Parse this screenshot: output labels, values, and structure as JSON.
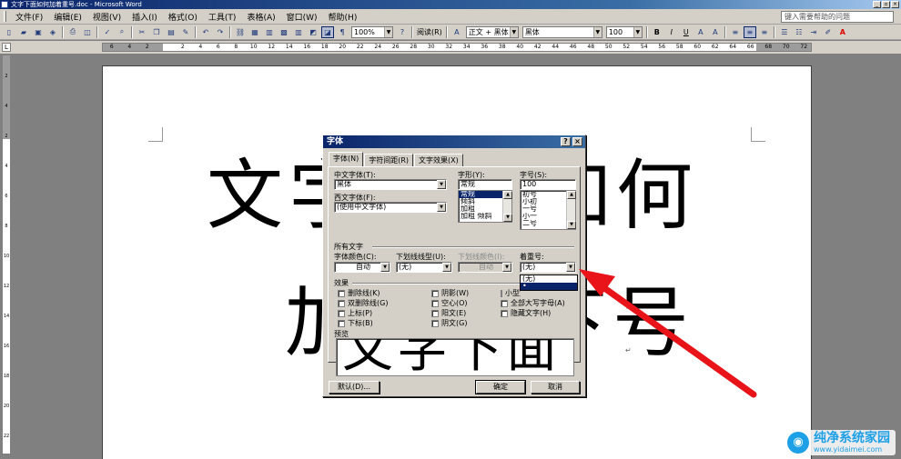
{
  "window": {
    "title": "文字下面如何加着重号.doc - Microsoft Word",
    "buttons": [
      "_",
      "▫",
      "×"
    ]
  },
  "menubar": {
    "items": [
      "文件(F)",
      "编辑(E)",
      "视图(V)",
      "插入(I)",
      "格式(O)",
      "工具(T)",
      "表格(A)",
      "窗口(W)",
      "帮助(H)"
    ],
    "help_placeholder": "键入需要帮助的问题"
  },
  "toolbar": {
    "zoom": "100%",
    "read_label": "阅读(R)",
    "style": "正文 + 黑体",
    "font": "黑体",
    "size": "100",
    "bold": "B",
    "italic": "I",
    "underline": "U",
    "font_color": "A"
  },
  "ruler": {
    "corner": "L",
    "ticks": [
      "6",
      "4",
      "2",
      "",
      "2",
      "4",
      "6",
      "8",
      "10",
      "12",
      "14",
      "16",
      "18",
      "20",
      "22",
      "24",
      "26",
      "28",
      "30",
      "32",
      "34",
      "36",
      "38",
      "40",
      "42",
      "44",
      "46",
      "48",
      "50",
      "52",
      "54",
      "56",
      "58",
      "60",
      "62",
      "64",
      "66",
      "68",
      "70",
      "72"
    ],
    "vticks": [
      "2",
      "4",
      "2",
      "4",
      "6",
      "8",
      "10",
      "12",
      "14",
      "16",
      "18",
      "20",
      "22"
    ]
  },
  "document": {
    "line1": "文字下面如何",
    "line2": "加文字下号",
    "paragraph_mark": "↵"
  },
  "dialog": {
    "title": "字体",
    "help_btn": "?",
    "close_btn": "×",
    "tabs": [
      "字体(N)",
      "字符间距(R)",
      "文字效果(X)"
    ],
    "cn_font_label": "中文字体(T):",
    "cn_font_value": "黑体",
    "west_font_label": "西文字体(F):",
    "west_font_value": "(使用中文字体)",
    "style_label": "字形(Y):",
    "style_value": "常规",
    "style_list": [
      "常规",
      "倾斜",
      "加粗",
      "加粗 倾斜"
    ],
    "size_label": "字号(S):",
    "size_value": "100",
    "size_list": [
      "初号",
      "小初",
      "一号",
      "小一",
      "二号"
    ],
    "all_text_label": "所有文字",
    "color_label": "字体颜色(C):",
    "color_value": "自动",
    "underline_label": "下划线线型(U):",
    "underline_value": "(无)",
    "underline_color_label": "下划线颜色(I):",
    "underline_color_value": "自动",
    "emphasis_label": "着重号:",
    "emphasis_value": "(无)",
    "emphasis_options": [
      "(无)",
      "•"
    ],
    "effects_label": "效果",
    "effects": [
      {
        "label": "删除线(K)"
      },
      {
        "label": "双删除线(G)"
      },
      {
        "label": "上标(P)"
      },
      {
        "label": "下标(B)"
      },
      {
        "label": "阴影(W)"
      },
      {
        "label": "空心(O)"
      },
      {
        "label": "阳文(E)"
      },
      {
        "label": "阴文(G)"
      },
      {
        "label": "小型大写字母(M)"
      },
      {
        "label": "全部大写字母(A)"
      },
      {
        "label": "隐藏文字(H)"
      }
    ],
    "preview_label": "预览",
    "preview_text": "文字下面",
    "default_btn": "默认(D)...",
    "ok_btn": "确定",
    "cancel_btn": "取消"
  },
  "watermark": {
    "title": "纯净系统家园",
    "url": "www.yidaimei.com"
  },
  "colors": {
    "arrow": "#e8141a",
    "titlebar": "#0a246a"
  }
}
